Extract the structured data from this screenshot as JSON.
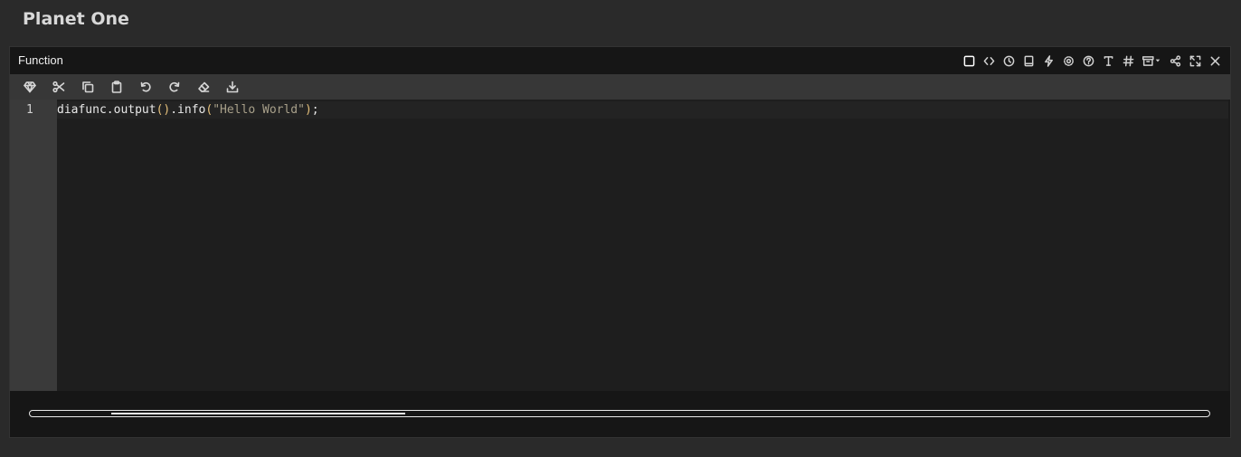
{
  "app": {
    "title": "Planet One"
  },
  "panel": {
    "title": "Function",
    "header_icons": [
      "square-icon",
      "code-icon",
      "clock-icon",
      "book-icon",
      "bolt-icon",
      "gear-icon",
      "help-icon",
      "text-icon",
      "hash-icon",
      "archive-dropdown-icon",
      "share-icon",
      "expand-icon",
      "close-icon"
    ]
  },
  "toolbar": {
    "icons": [
      "gem-icon",
      "scissors-icon",
      "copy-icon",
      "clipboard-icon",
      "undo-icon",
      "redo-icon",
      "eraser-icon",
      "download-icon"
    ]
  },
  "editor": {
    "line_numbers": [
      "1"
    ],
    "code": {
      "part1": "diafunc.output",
      "paren1": "()",
      "part2": ".info",
      "paren_open": "(",
      "string": "\"Hello World\"",
      "paren_close": ")",
      "end": ";"
    }
  },
  "scrollbar": {
    "position_fraction": 0.07,
    "visible_fraction": 0.25
  }
}
